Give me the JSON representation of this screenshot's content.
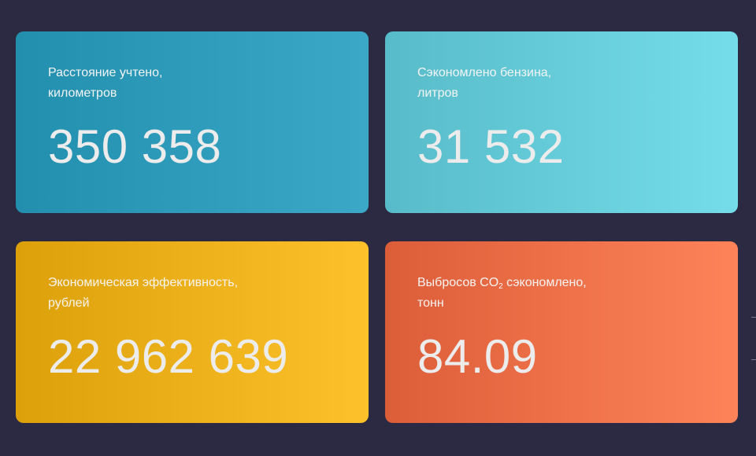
{
  "cards": [
    {
      "line1": "Расстояние учтено,",
      "line2": "километров",
      "value": "350 358"
    },
    {
      "line1": "Сэкономлено бензина,",
      "line2": "литров",
      "value": "31 532"
    },
    {
      "line1": "Экономическая эффективность,",
      "line2": "рублей",
      "value": "22 962 639"
    },
    {
      "line1_prefix": "Выбросов CO",
      "line1_sub": "2",
      "line1_suffix": " сэкономлено,",
      "line2": "тонн",
      "value": "84.09"
    }
  ],
  "colors": {
    "background": "#2b2a42",
    "card_blue": "#218fad",
    "card_cyan": "#74dde9",
    "card_yellow": "#fdc12b",
    "card_orange": "#fe8359"
  }
}
